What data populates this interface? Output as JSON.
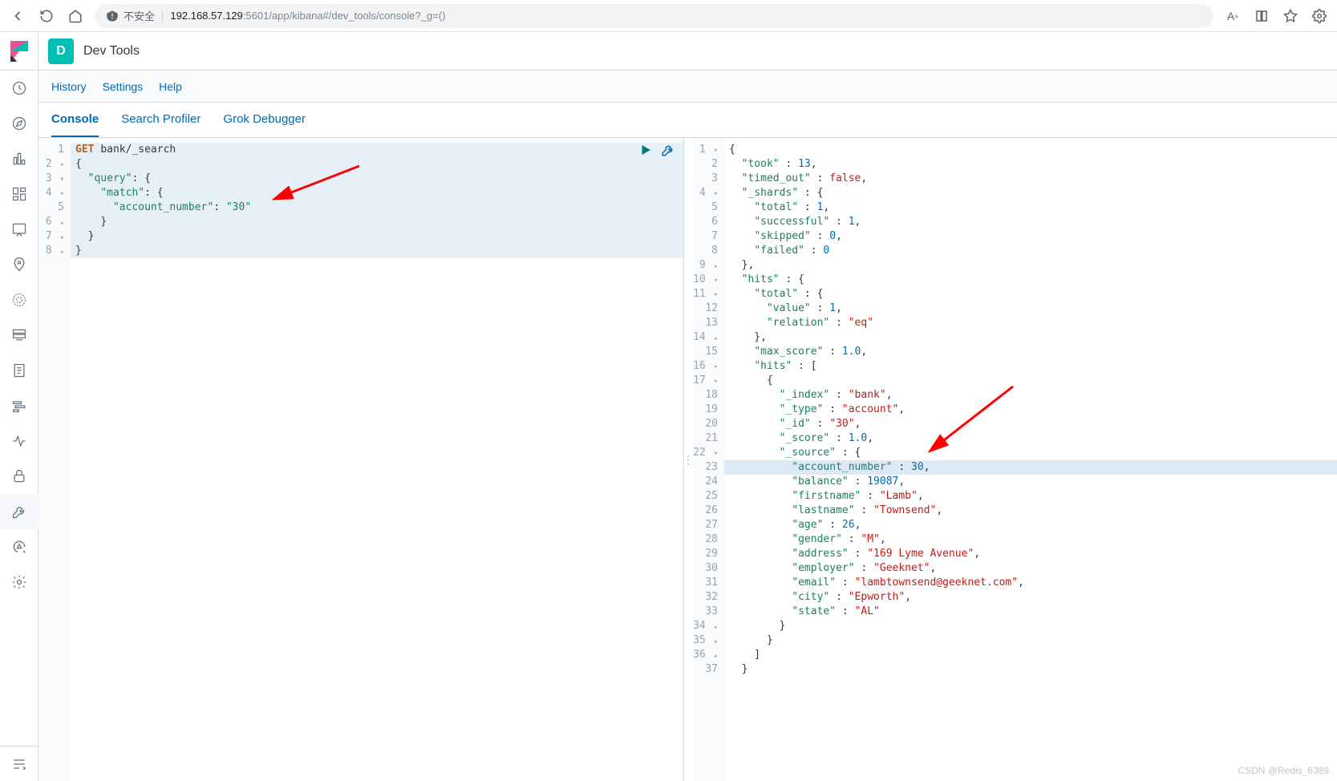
{
  "browser": {
    "security_label": "不安全",
    "url_host": "192.168.57.129",
    "url_port": ":5601",
    "url_path": "/app/kibana#/dev_tools/console?_g=()"
  },
  "header": {
    "badge": "D",
    "title": "Dev Tools"
  },
  "subnav": {
    "history": "History",
    "settings": "Settings",
    "help": "Help"
  },
  "tabs": {
    "console": "Console",
    "profiler": "Search Profiler",
    "grok": "Grok Debugger"
  },
  "request": {
    "method": "GET",
    "endpoint": "bank/_search",
    "lines": [
      "1",
      "2",
      "3",
      "4",
      "5",
      "6",
      "7",
      "8"
    ],
    "body": {
      "open": "{",
      "query_key": "\"query\"",
      "match_key": "\"match\"",
      "acct_key": "\"account_number\"",
      "acct_val": "\"30\"",
      "close_inner": "}",
      "close_mid": "}",
      "close": "}"
    }
  },
  "response": {
    "lines": [
      "1",
      "2",
      "3",
      "4",
      "5",
      "6",
      "7",
      "8",
      "9",
      "10",
      "11",
      "12",
      "13",
      "14",
      "15",
      "16",
      "17",
      "18",
      "19",
      "20",
      "21",
      "22",
      "23",
      "24",
      "25",
      "26",
      "27",
      "28",
      "29",
      "30",
      "31",
      "32",
      "33",
      "34",
      "35",
      "36",
      "37"
    ],
    "data": {
      "took": 13,
      "timed_out": "false",
      "shards": {
        "total": 1,
        "successful": 1,
        "skipped": 0,
        "failed": 0
      },
      "hits": {
        "total": {
          "value": 1,
          "relation": "eq"
        },
        "max_score": "1.0",
        "hits": [
          {
            "_index": "bank",
            "_type": "account",
            "_id": "30",
            "_score": "1.0",
            "_source": {
              "account_number": 30,
              "balance": 19087,
              "firstname": "Lamb",
              "lastname": "Townsend",
              "age": 26,
              "gender": "M",
              "address": "169 Lyme Avenue",
              "employer": "Geeknet",
              "email": "lambtownsend@geeknet.com",
              "city": "Epworth",
              "state": "AL"
            }
          }
        ]
      }
    }
  },
  "watermark": "CSDN @Redis_6389"
}
